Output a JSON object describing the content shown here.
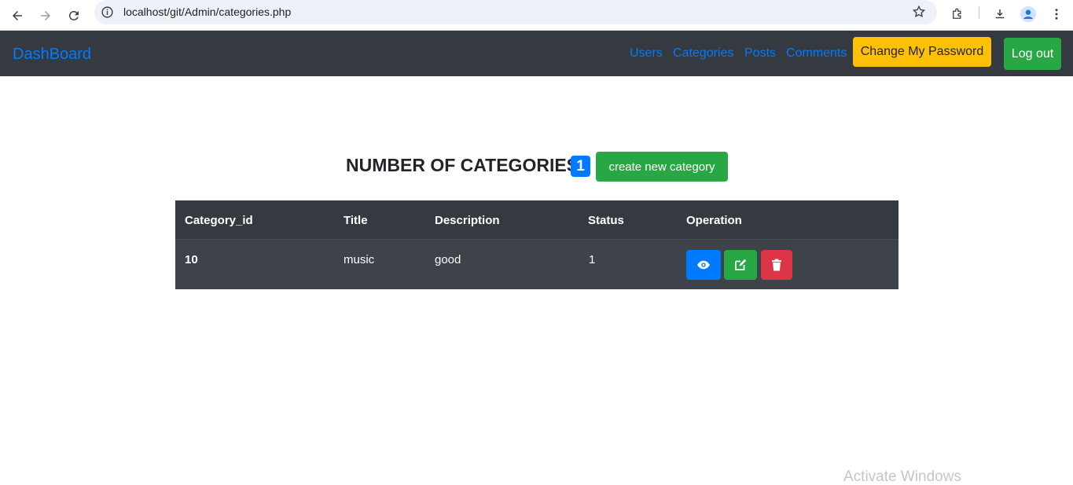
{
  "browser": {
    "url": "localhost/git/Admin/categories.php"
  },
  "navbar": {
    "brand": "DashBoard",
    "links": [
      "Users",
      "Categories",
      "Posts",
      "Comments"
    ],
    "change_password_label": "Change My Password",
    "logout_label": "Log out"
  },
  "main": {
    "heading": "NUMBER OF CATEGORIES",
    "count": "1",
    "create_label": "create new category"
  },
  "table": {
    "headers": [
      "Category_id",
      "Title",
      "Description",
      "Status",
      "Operation"
    ],
    "rows": [
      {
        "id": "10",
        "title": "music",
        "description": "good",
        "status": "1"
      }
    ]
  },
  "operations": [
    "eye-icon",
    "edit-icon",
    "trash-icon"
  ],
  "watermark": "Activate Windows",
  "colors": {
    "navbar_bg": "#343a40",
    "primary": "#007bff",
    "success": "#28a745",
    "warning": "#ffc107",
    "danger": "#dc3545"
  }
}
